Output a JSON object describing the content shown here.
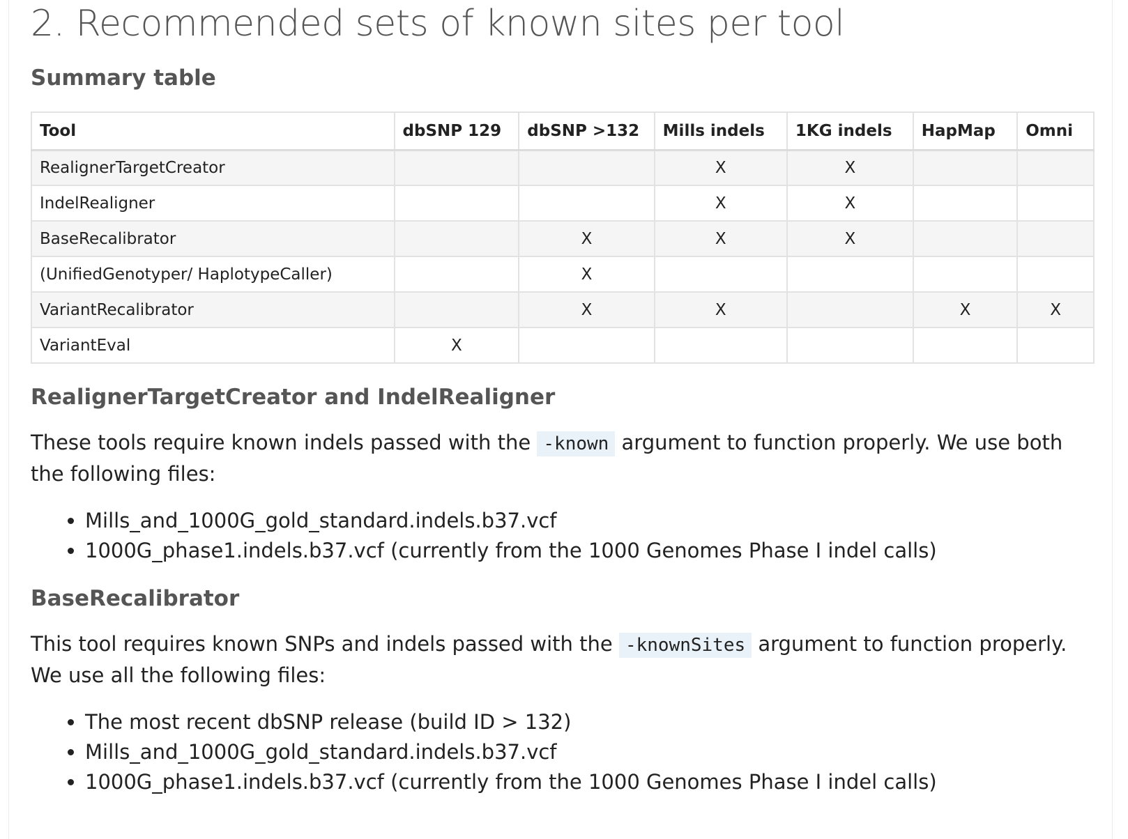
{
  "page_title": "2. Recommended sets of known sites per tool",
  "summary": {
    "heading": "Summary table",
    "columns": [
      "Tool",
      "dbSNP 129",
      "dbSNP >132",
      "Mills indels",
      "1KG indels",
      "HapMap",
      "Omni"
    ],
    "rows": [
      [
        "RealignerTargetCreator",
        "",
        "",
        "X",
        "X",
        "",
        ""
      ],
      [
        "IndelRealigner",
        "",
        "",
        "X",
        "X",
        "",
        ""
      ],
      [
        "BaseRecalibrator",
        "",
        "X",
        "X",
        "X",
        "",
        ""
      ],
      [
        "(UnifiedGenotyper/ HaplotypeCaller)",
        "",
        "X",
        "",
        "",
        "",
        ""
      ],
      [
        "VariantRecalibrator",
        "",
        "X",
        "X",
        "",
        "X",
        "X"
      ],
      [
        "VariantEval",
        "X",
        "",
        "",
        "",
        "",
        ""
      ]
    ]
  },
  "realigner": {
    "heading": "RealignerTargetCreator and IndelRealigner",
    "text_before": "These tools require known indels passed with the ",
    "code": "-known",
    "text_after": " argument to function properly. We use both the following files:",
    "files": [
      "Mills_and_1000G_gold_standard.indels.b37.vcf",
      "1000G_phase1.indels.b37.vcf (currently from the 1000 Genomes Phase I indel calls)"
    ]
  },
  "baserecal": {
    "heading": "BaseRecalibrator",
    "text_before": "This tool requires known SNPs and indels passed with the ",
    "code": "-knownSites",
    "text_after": " argument to function properly. We use all the following files:",
    "files": [
      "The most recent dbSNP release (build ID > 132)",
      "Mills_and_1000G_gold_standard.indels.b37.vcf",
      "1000G_phase1.indels.b37.vcf (currently from the 1000 Genomes Phase I indel calls)"
    ]
  }
}
